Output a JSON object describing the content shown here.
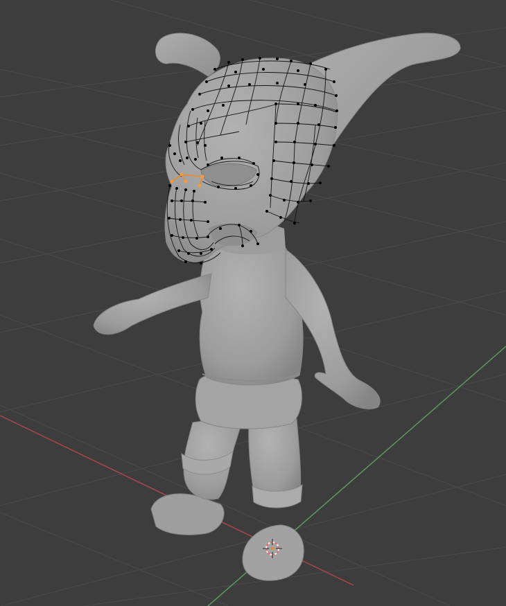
{
  "viewport": {
    "background": "#3d3d3d",
    "grid_color": "#4a4a4a",
    "x_axis_color": "#a8474a",
    "y_axis_color": "#5c9a5c"
  },
  "model": {
    "surface_color": "#a3a3a3",
    "shadow_color": "#8a8a8a",
    "wire_color": "#111111",
    "selection_color": "#f08a24"
  },
  "cursor": {
    "icon": "3d-cursor-icon",
    "ring_colors": [
      "#e86a6a",
      "#ffffff"
    ]
  }
}
